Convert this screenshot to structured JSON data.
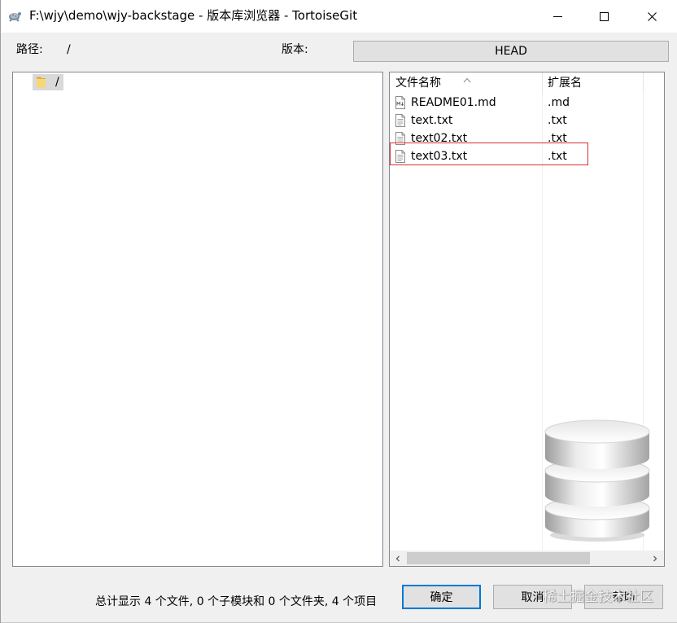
{
  "window": {
    "title": "F:\\wjy\\demo\\wjy-backstage - 版本库浏览器 - TortoiseGit",
    "app_icon": "tortoisegit-icon",
    "controls": [
      "minimize-icon",
      "maximize-icon",
      "close-icon"
    ]
  },
  "toolbar": {
    "path_label": "路径:",
    "path_value": "/",
    "revision_label": "版本:",
    "revision_button": "HEAD"
  },
  "tree": {
    "items": [
      {
        "label": "/",
        "icon": "folder-icon",
        "selected": true
      }
    ]
  },
  "file_list": {
    "columns": [
      {
        "label": "文件名称",
        "sort_icon": "sort-ascending-icon"
      },
      {
        "label": "扩展名"
      }
    ],
    "rows": [
      {
        "name": "README01.md",
        "ext": ".md",
        "icon": "markdown-file-icon"
      },
      {
        "name": "text.txt",
        "ext": ".txt",
        "icon": "text-file-icon"
      },
      {
        "name": "text02.txt",
        "ext": ".txt",
        "icon": "text-file-icon"
      },
      {
        "name": "text03.txt",
        "ext": ".txt",
        "icon": "text-file-icon",
        "highlighted": true
      }
    ],
    "background_icon": "database-icon",
    "scrollbar": {
      "left_icon": "chevron-left-icon",
      "right_icon": "chevron-right-icon"
    }
  },
  "status_bar": {
    "summary": "总计显示 4 个文件, 0 个子模块和 0 个文件夹, 4 个项目"
  },
  "buttons": {
    "ok": "确定",
    "cancel": "取消",
    "help": "帮助"
  },
  "watermark": "稀土掘金技术社区",
  "colors": {
    "annotation_box": "#d32f2f",
    "default_button_border": "#0078d7",
    "selection": "#d9d9d9"
  }
}
